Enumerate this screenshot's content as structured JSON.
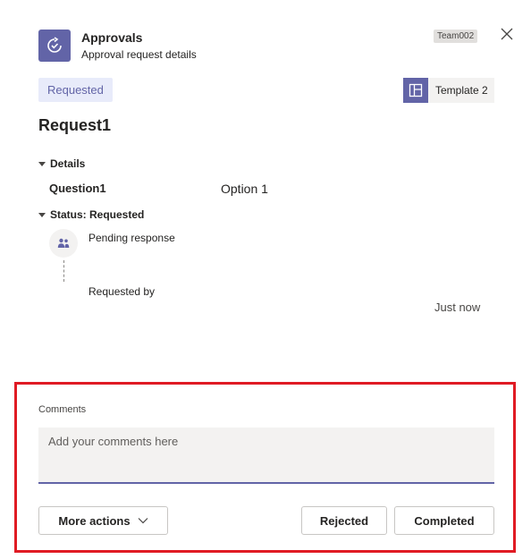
{
  "header": {
    "app_title": "Approvals",
    "app_subtitle": "Approval request details",
    "team_badge": "Team002",
    "app_icon": "approvals-icon",
    "close_icon": "close-icon",
    "accent_color": "#6264a7"
  },
  "status": {
    "pill_label": "Requested"
  },
  "template": {
    "label": "Template 2",
    "icon": "template-icon"
  },
  "request": {
    "title": "Request1"
  },
  "details": {
    "section_label": "Details",
    "question_label": "Question1",
    "question_value": "Option 1"
  },
  "status_section": {
    "section_label": "Status: Requested",
    "pending_text": "Pending response",
    "requested_by_label": "Requested by",
    "timestamp": "Just now",
    "avatar_icon": "people-icon"
  },
  "comments": {
    "label": "Comments",
    "placeholder": "Add your comments here",
    "value": ""
  },
  "actions": {
    "more_label": "More actions",
    "rejected_label": "Rejected",
    "completed_label": "Completed"
  },
  "highlight_color": "#e01b24"
}
